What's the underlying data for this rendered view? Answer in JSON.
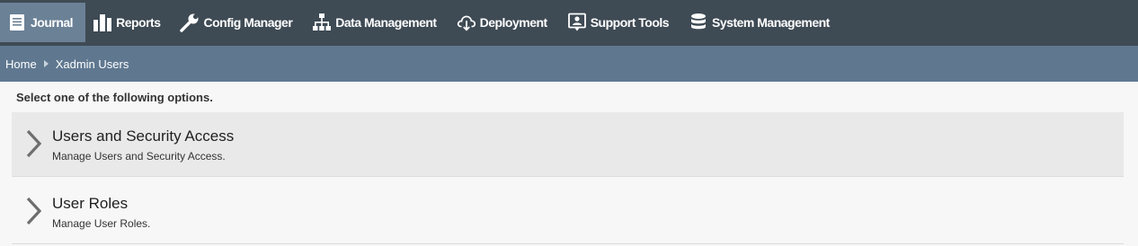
{
  "nav": {
    "items": [
      {
        "label": "Journal",
        "icon": "journal-icon",
        "active": true
      },
      {
        "label": "Reports",
        "icon": "bar-chart-icon",
        "active": false
      },
      {
        "label": "Config Manager",
        "icon": "wrench-icon",
        "active": false
      },
      {
        "label": "Data Management",
        "icon": "hierarchy-icon",
        "active": false
      },
      {
        "label": "Deployment",
        "icon": "cloud-download-icon",
        "active": false
      },
      {
        "label": "Support Tools",
        "icon": "support-user-icon",
        "active": false
      },
      {
        "label": "System Management",
        "icon": "database-icon",
        "active": false
      }
    ]
  },
  "breadcrumb": {
    "home": "Home",
    "current": "Xadmin Users"
  },
  "main": {
    "instructions": "Select one of the following options.",
    "options": [
      {
        "title": "Users and Security Access",
        "description": "Manage Users and Security Access."
      },
      {
        "title": "User Roles",
        "description": "Manage User Roles."
      }
    ]
  },
  "colors": {
    "topnav_bg": "#3e4a54",
    "active_tab_bg": "#6b8196",
    "breadcrumb_bg": "#5f7890",
    "highlight_row_bg": "#e9e9ea"
  }
}
